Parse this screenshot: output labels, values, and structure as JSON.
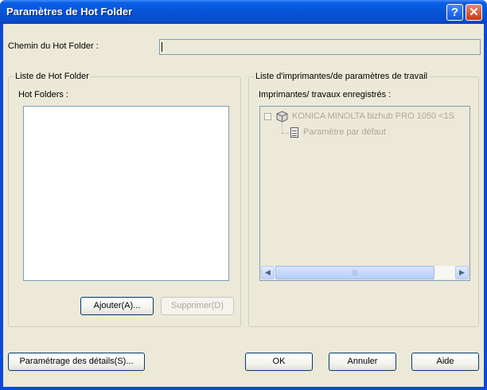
{
  "window": {
    "title": "Paramètres de Hot Folder",
    "help_glyph": "?",
    "close_glyph": "✕"
  },
  "path": {
    "label": "Chemin du Hot Folder :",
    "value": ""
  },
  "hot_folder_list": {
    "group_title": "Liste de Hot Folder",
    "list_label": "Hot Folders :",
    "items": [],
    "add_button": "Ajouter(A)...",
    "remove_button": "Supprimer(D)"
  },
  "printer_list": {
    "group_title": "Liste d'imprimantes/de paramètres de travail",
    "list_label": "Imprimantes/ travaux enregistrés :",
    "tree": {
      "printer": "KONICA MINOLTA bizhub PRO 1050 <1S",
      "expander": "−",
      "child": "Paramètre par défaut"
    },
    "scroll_left": "◀",
    "scroll_right": "▶",
    "scroll_grip": "|||"
  },
  "footer": {
    "details_button": "Paramétrage des détails(S)...",
    "ok_button": "OK",
    "cancel_button": "Annuler",
    "help_button": "Aide"
  },
  "icons": {
    "help": "help-icon",
    "close": "close-icon",
    "printer": "printer-icon",
    "document": "document-icon"
  },
  "colors": {
    "titlebar": "#0553d6",
    "dialog_bg": "#ece9d8",
    "field_border": "#7f9db9",
    "disabled_text": "#aca899"
  }
}
